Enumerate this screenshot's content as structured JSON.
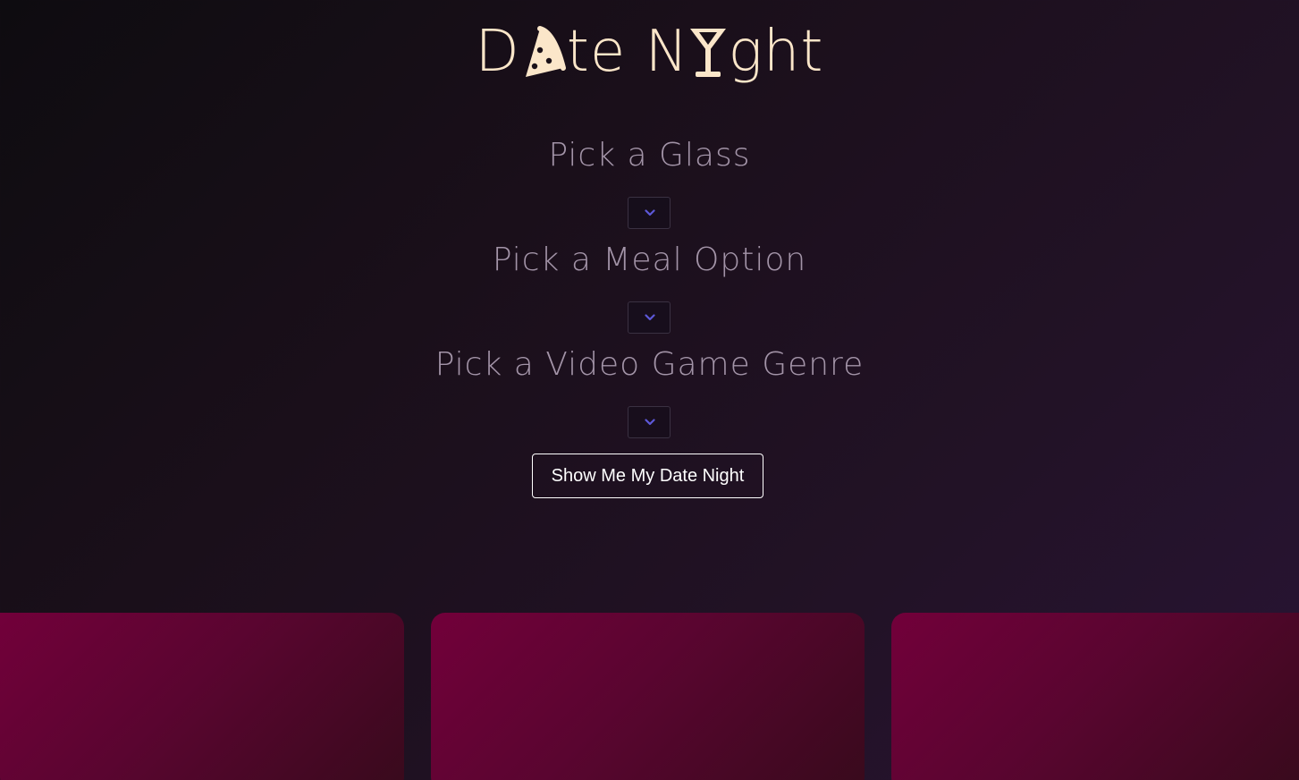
{
  "logo": {
    "text_1": "D",
    "pizza_icon": "pizza-slice-icon",
    "text_2": "te N",
    "cocktail_icon": "cocktail-glass-icon",
    "text_3": "ght"
  },
  "sections": [
    {
      "title": "Pick a Glass",
      "dropdown_icon": "chevron-down-icon"
    },
    {
      "title": "Pick a Meal Option",
      "dropdown_icon": "chevron-down-icon"
    },
    {
      "title": "Pick a Video Game Genre",
      "dropdown_icon": "chevron-down-icon"
    }
  ],
  "submit_label": "Show Me My Date Night",
  "colors": {
    "logo": "#fbe6c9",
    "heading": "#a394a8",
    "chevron": "#5d58d8",
    "card_top": "#72003a",
    "card_bottom": "#380a1c"
  }
}
